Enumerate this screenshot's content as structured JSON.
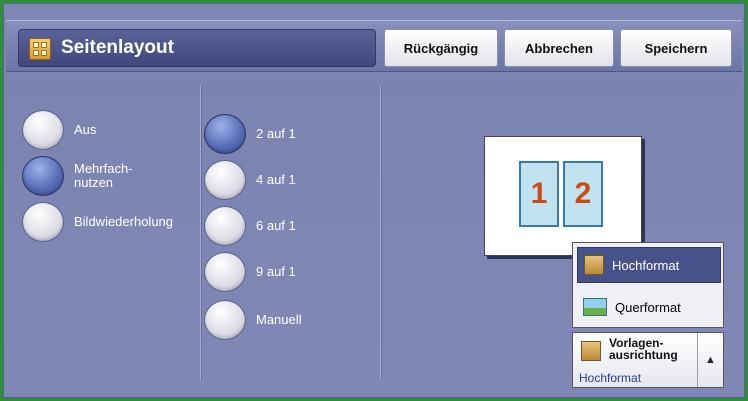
{
  "header": {
    "title": "Seitenlayout",
    "icon": "layout-grid-icon",
    "undo_label": "Rückgängig",
    "cancel_label": "Abbrechen",
    "save_label": "Speichern"
  },
  "mode_options": [
    {
      "label": "Aus",
      "selected": false
    },
    {
      "label": "Mehrfach-\nnutzen",
      "selected": true
    },
    {
      "label": "Bildwiederholung",
      "selected": false
    }
  ],
  "pages_options": [
    {
      "label": "2 auf 1",
      "selected": true
    },
    {
      "label": "4 auf 1",
      "selected": false
    },
    {
      "label": "6 auf 1",
      "selected": false
    },
    {
      "label": "9 auf 1",
      "selected": false
    },
    {
      "label": "Manuell",
      "selected": false
    }
  ],
  "preview": {
    "page1": "1",
    "page2": "2"
  },
  "orientation": {
    "options": [
      {
        "label": "Hochformat",
        "icon": "portrait-icon",
        "selected": true
      },
      {
        "label": "Querformat",
        "icon": "landscape-icon",
        "selected": false
      }
    ],
    "title": "Vorlagen-\nausrichtung",
    "value": "Hochformat",
    "arrow": "▲"
  },
  "colors": {
    "background": "#7f86b3",
    "header": "#6c74a6",
    "accent": "#48528a",
    "frame": "#2e8f3a"
  }
}
